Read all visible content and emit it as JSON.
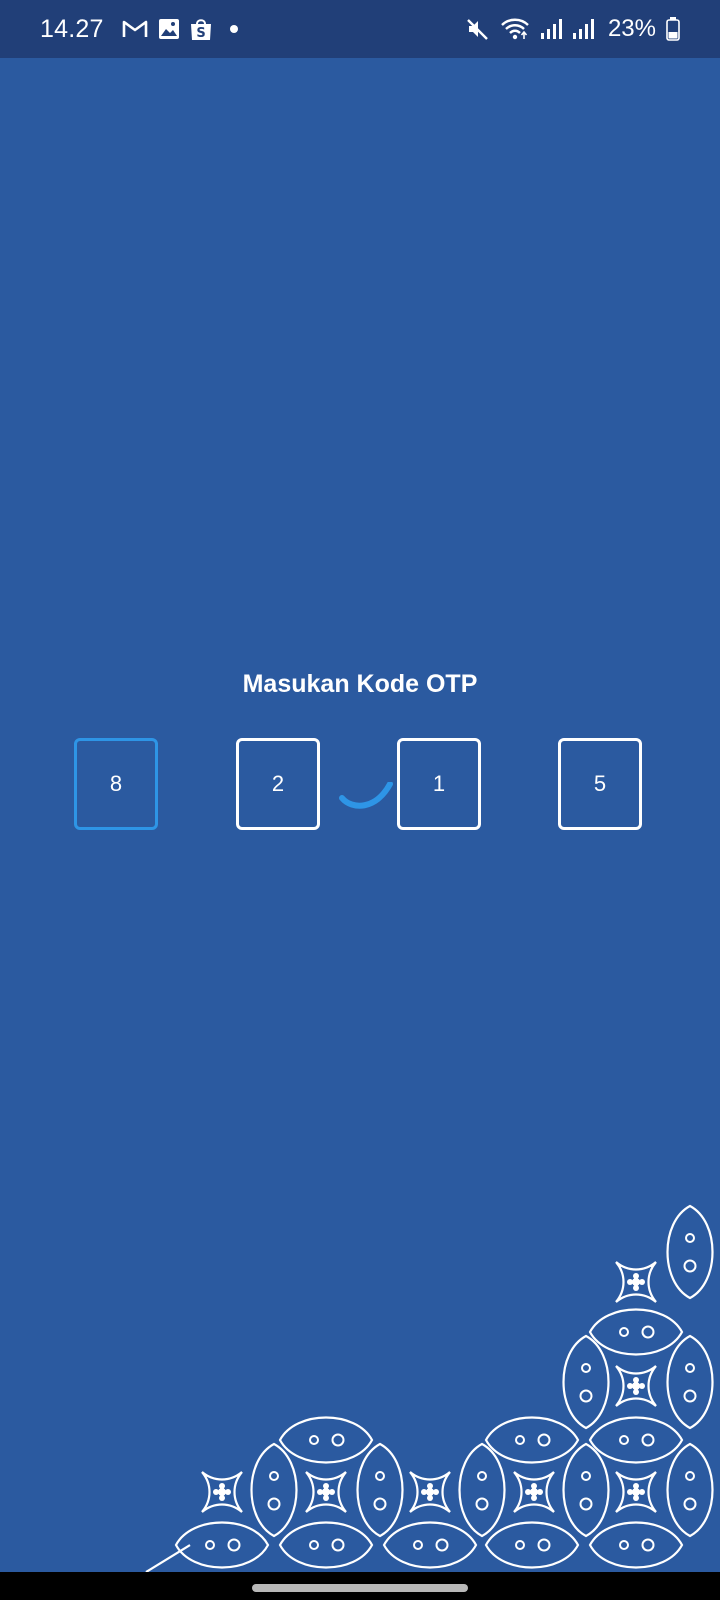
{
  "status_bar": {
    "time": "14.27",
    "battery": "23%",
    "icons_left": [
      "gmail-icon",
      "gallery-icon",
      "shopee-icon",
      "dot-icon"
    ],
    "icons_right": [
      "mute-icon",
      "wifi-icon",
      "signal-icon",
      "signal-icon",
      "battery-icon"
    ]
  },
  "otp": {
    "title": "Masukan Kode OTP",
    "digits": [
      "8",
      "2",
      "1",
      "5"
    ]
  },
  "colors": {
    "background": "#2b5aa0",
    "status_bar": "#213f78",
    "accent": "#2e95e6"
  }
}
